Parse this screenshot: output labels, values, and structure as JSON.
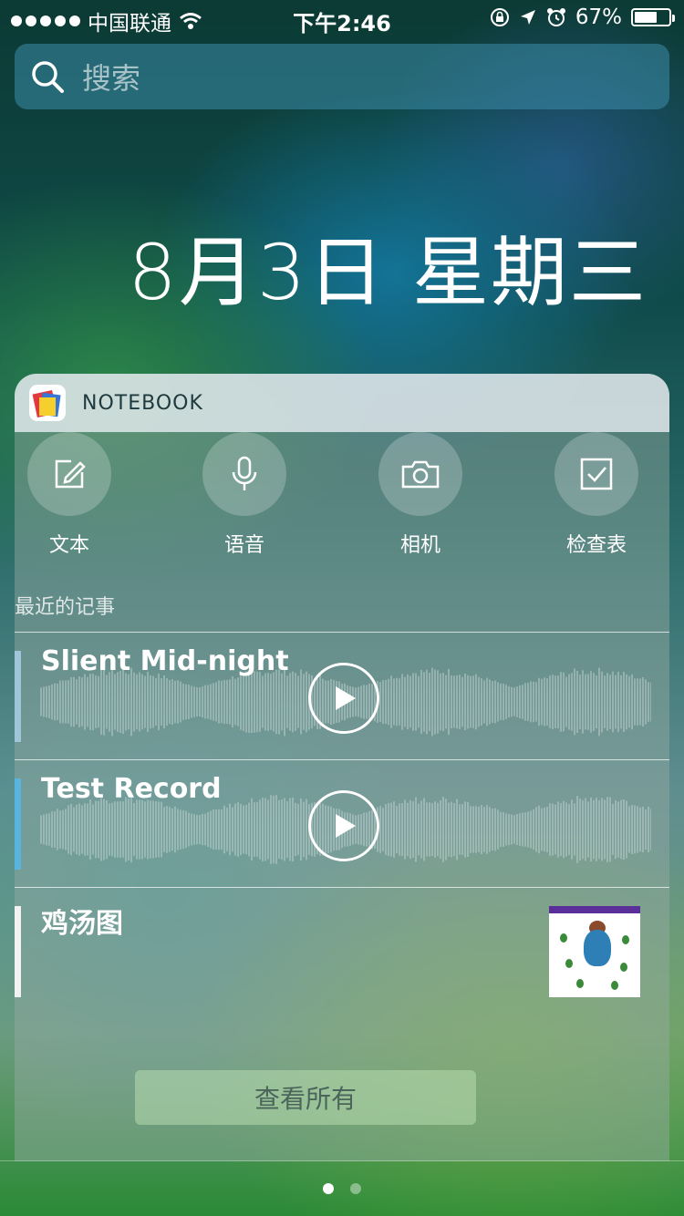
{
  "status_bar": {
    "carrier": "中国联通",
    "time": "下午2:46",
    "battery_percent": "67%",
    "battery_level": 0.67,
    "icons": [
      "signal-dots-icon",
      "wifi-icon",
      "rotation-lock-icon",
      "location-arrow-icon",
      "alarm-icon",
      "battery-icon"
    ]
  },
  "search": {
    "placeholder": "搜索"
  },
  "date": "8月3日 星期三",
  "widget": {
    "app_name": "NOTEBOOK",
    "actions": [
      {
        "label": "文本",
        "icon": "edit-icon"
      },
      {
        "label": "语音",
        "icon": "microphone-icon"
      },
      {
        "label": "相机",
        "icon": "camera-icon"
      },
      {
        "label": "检查表",
        "icon": "checklist-icon"
      }
    ],
    "recent_title": "最近的记事",
    "notes": [
      {
        "title": "Slient Mid-night",
        "type": "audio",
        "color": "#9fc6d8"
      },
      {
        "title": "Test Record",
        "type": "audio",
        "color": "#5ab4e0"
      },
      {
        "title": "鸡汤图",
        "type": "image",
        "color": "#f2f2f2"
      }
    ],
    "view_all": "查看所有"
  },
  "pagination": {
    "count": 2,
    "active": 0
  }
}
